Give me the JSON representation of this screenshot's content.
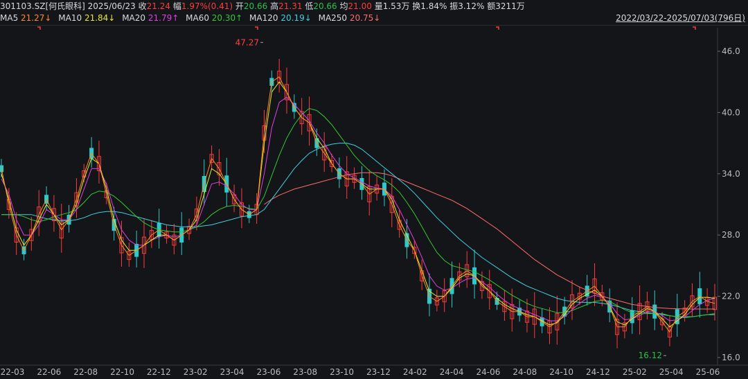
{
  "header": {
    "code": "301103.SZ[何氏眼科]",
    "date": "2025/06/23",
    "close_label": "收",
    "close": "21.24",
    "change_label": "幅",
    "change": "1.97%(0.41)",
    "open_label": "开",
    "open": "20.66",
    "high_label": "高",
    "high": "21.31",
    "low_label": "低",
    "low": "20.66",
    "avg_label": "均",
    "avg": "21.00",
    "volume": "量1.53万",
    "turnover": "换1.84%",
    "amplitude": "振3.12%",
    "amount": "额3211万"
  },
  "ma": [
    {
      "label": "MA5",
      "value": "21.27↓",
      "color": "#f0f0f0",
      "value_color": "#ff8c1a"
    },
    {
      "label": "MA10",
      "value": "21.84↓",
      "color": "#f0f0f0",
      "value_color": "#e8e82a"
    },
    {
      "label": "MA20",
      "value": "21.79↑",
      "color": "#f0f0f0",
      "value_color": "#e040e0"
    },
    {
      "label": "MA60",
      "value": "20.30↑",
      "color": "#f0f0f0",
      "value_color": "#32c832"
    },
    {
      "label": "MA120",
      "value": "20.19↓",
      "color": "#f0f0f0",
      "value_color": "#40d0e0"
    },
    {
      "label": "MA250",
      "value": "20.75↓",
      "color": "#f0f0f0",
      "value_color": "#ff6b6b"
    }
  ],
  "range": "2022/03/22-2025/07/03(796日)",
  "chart_data": {
    "type": "line",
    "x_ticks": [
      "22-03",
      "22-06",
      "22-08",
      "22-10",
      "22-12",
      "23-02",
      "23-04",
      "23-06",
      "23-08",
      "23-10",
      "23-12",
      "24-02",
      "24-04",
      "24-06",
      "24-08",
      "24-10",
      "24-12",
      "25-02",
      "25-04",
      "25-06"
    ],
    "y_ticks": [
      "46.0",
      "40.0",
      "34.0",
      "28.0",
      "22.0",
      "16.0"
    ],
    "ylim": [
      16.0,
      46.0
    ],
    "annotations": [
      {
        "text": "47.27",
        "value": 47.27,
        "color": "#ff4040"
      },
      {
        "text": "16.12",
        "value": 16.12,
        "color": "#27c24c"
      }
    ],
    "series": [
      {
        "name": "MA5",
        "color": "#ff8c1a",
        "values": [
          34.5,
          31,
          28,
          26.5,
          28,
          30,
          31.5,
          30,
          28.5,
          29.5,
          31.5,
          34,
          36,
          35,
          32,
          29,
          27,
          26,
          26.5,
          27,
          28,
          28.5,
          28,
          27.5,
          28,
          28.5,
          30,
          33,
          35.5,
          34.5,
          33,
          31.5,
          30.5,
          30,
          30.5,
          38,
          43,
          43.5,
          42,
          40.5,
          39.5,
          39,
          37,
          36,
          35,
          34,
          33.5,
          33.5,
          33,
          32,
          32.5,
          32.5,
          31,
          29,
          27.5,
          26.5,
          24,
          22,
          21.5,
          22,
          23,
          24,
          24.5,
          24,
          23,
          22.5,
          21.5,
          21,
          20.5,
          20.5,
          20,
          20,
          19.5,
          19,
          19.5,
          20.5,
          21.5,
          22,
          22.5,
          23,
          22,
          21,
          19,
          19,
          20,
          20.5,
          21,
          20.5,
          19.5,
          18.5,
          20,
          20.5,
          21.5,
          22,
          21.5,
          21.3
        ]
      },
      {
        "name": "MA10",
        "color": "#e8e82a",
        "values": [
          34,
          31.5,
          28.5,
          27,
          28,
          29.5,
          31,
          30,
          29,
          29.5,
          31,
          33.5,
          35.5,
          35,
          32.5,
          29.5,
          27.5,
          26.5,
          26.5,
          27,
          27.5,
          28,
          28,
          27.5,
          28,
          28.5,
          29.5,
          32,
          34.5,
          34,
          33,
          31.5,
          30.5,
          30,
          30.5,
          37,
          42,
          43,
          42,
          40.5,
          39.5,
          39,
          37.5,
          36.5,
          35,
          34,
          33.5,
          33.5,
          33,
          32.5,
          32.5,
          32.5,
          31.5,
          29.5,
          28,
          26.5,
          24.5,
          22.5,
          22,
          22,
          22.8,
          23.8,
          24.2,
          24,
          23.2,
          22.5,
          21.8,
          21.2,
          20.8,
          20.5,
          20.2,
          20,
          19.6,
          19.2,
          19.4,
          20.2,
          21.2,
          21.8,
          22.2,
          22.6,
          22,
          21,
          19.5,
          19.2,
          19.8,
          20.3,
          20.8,
          20.5,
          19.8,
          19,
          19.6,
          20.2,
          21.2,
          21.9,
          21.9,
          21.8
        ]
      },
      {
        "name": "MA20",
        "color": "#e040e0",
        "values": [
          33.5,
          32,
          29.5,
          28,
          28,
          29,
          30.5,
          30,
          29.5,
          29.5,
          30.5,
          32.5,
          34.5,
          34.5,
          33,
          30.5,
          28.5,
          27.5,
          27,
          27,
          27.5,
          27.8,
          28,
          27.8,
          28,
          28.5,
          29,
          31,
          33,
          33.2,
          32.8,
          32,
          31,
          30.5,
          30.5,
          34,
          38.5,
          41,
          41.5,
          40.8,
          40,
          39.2,
          38,
          37,
          35.8,
          34.8,
          34,
          33.6,
          33.2,
          32.8,
          32.6,
          32.5,
          31.8,
          30.5,
          29,
          27.5,
          25.8,
          24,
          23,
          22.6,
          22.8,
          23.3,
          23.7,
          23.8,
          23.4,
          22.9,
          22.2,
          21.6,
          21.1,
          20.8,
          20.5,
          20.2,
          19.9,
          19.6,
          19.6,
          20,
          20.7,
          21.3,
          21.8,
          22.1,
          21.9,
          21.3,
          20.3,
          19.7,
          19.8,
          20.1,
          20.5,
          20.5,
          20.1,
          19.6,
          19.7,
          20,
          20.6,
          21.2,
          21.6,
          21.8
        ]
      },
      {
        "name": "MA60",
        "color": "#32c832",
        "values": [
          30,
          30,
          30,
          29.8,
          29.5,
          29.3,
          29.5,
          29.8,
          30,
          30.2,
          30.5,
          31.2,
          32,
          32.3,
          32.2,
          31.8,
          31.2,
          30.5,
          29.8,
          29.2,
          28.8,
          28.5,
          28.4,
          28.3,
          28.3,
          28.5,
          28.8,
          29.3,
          30,
          30.5,
          30.8,
          30.9,
          30.8,
          30.6,
          30.5,
          31.8,
          33.8,
          35.8,
          37.5,
          38.8,
          39.8,
          40.4,
          40.2,
          39.6,
          38.8,
          37.8,
          36.8,
          35.8,
          35,
          34.3,
          33.8,
          33.4,
          32.9,
          32.2,
          31.2,
          30.1,
          28.8,
          27.5,
          26.3,
          25.5,
          25,
          24.8,
          24.6,
          24.4,
          24,
          23.6,
          23.1,
          22.6,
          22.1,
          21.7,
          21.3,
          21,
          20.8,
          20.6,
          20.4,
          20.4,
          20.6,
          20.9,
          21.2,
          21.5,
          21.6,
          21.5,
          21.1,
          20.7,
          20.4,
          20.3,
          20.3,
          20.3,
          20.3,
          20.1,
          20,
          19.9,
          20,
          20.1,
          20.2,
          20.3
        ]
      },
      {
        "name": "MA120",
        "color": "#40d0e0",
        "values": [
          30,
          30,
          30,
          30,
          30,
          29.8,
          29.6,
          29.5,
          29.4,
          29.4,
          29.5,
          29.7,
          30,
          30.2,
          30.3,
          30.3,
          30.2,
          30,
          29.8,
          29.6,
          29.4,
          29.2,
          29,
          28.9,
          28.8,
          28.8,
          28.8,
          28.9,
          29,
          29.2,
          29.4,
          29.6,
          29.8,
          29.9,
          30,
          30.5,
          31.5,
          32.5,
          33.5,
          34.5,
          35.3,
          36,
          36.4,
          36.7,
          36.9,
          37,
          37,
          36.8,
          36.4,
          35.8,
          35.2,
          34.6,
          34,
          33.4,
          32.8,
          32.1,
          31.3,
          30.5,
          29.7,
          29,
          28.3,
          27.6,
          27,
          26.4,
          25.8,
          25.3,
          24.8,
          24.3,
          23.8,
          23.4,
          23,
          22.7,
          22.4,
          22.1,
          21.8,
          21.6,
          21.5,
          21.4,
          21.4,
          21.4,
          21.3,
          21.2,
          21,
          20.8,
          20.6,
          20.5,
          20.4,
          20.3,
          20.2,
          20.1,
          20,
          20,
          20,
          20.1,
          20.2,
          20.2
        ]
      },
      {
        "name": "MA250",
        "color": "#ff6b6b",
        "values": [
          null,
          null,
          null,
          null,
          null,
          null,
          null,
          null,
          null,
          null,
          null,
          null,
          null,
          null,
          null,
          null,
          null,
          null,
          null,
          null,
          null,
          null,
          null,
          null,
          null,
          null,
          null,
          null,
          null,
          null,
          null,
          null,
          null,
          null,
          null,
          31,
          31.5,
          31.9,
          32.2,
          32.5,
          32.7,
          32.9,
          33.1,
          33.3,
          33.5,
          33.7,
          33.9,
          34,
          34.1,
          34.1,
          34.1,
          34,
          33.8,
          33.5,
          33.2,
          32.9,
          32.6,
          32.3,
          32,
          31.7,
          31.4,
          31,
          30.6,
          30.1,
          29.6,
          29.1,
          28.6,
          28,
          27.4,
          26.8,
          26.2,
          25.6,
          25.1,
          24.6,
          24.1,
          23.7,
          23.3,
          22.9,
          22.6,
          22.3,
          22,
          21.8,
          21.6,
          21.4,
          21.2,
          21.1,
          21,
          20.9,
          20.85,
          20.8,
          20.78,
          20.76,
          20.75,
          20.75,
          20.75,
          20.75
        ]
      }
    ]
  }
}
